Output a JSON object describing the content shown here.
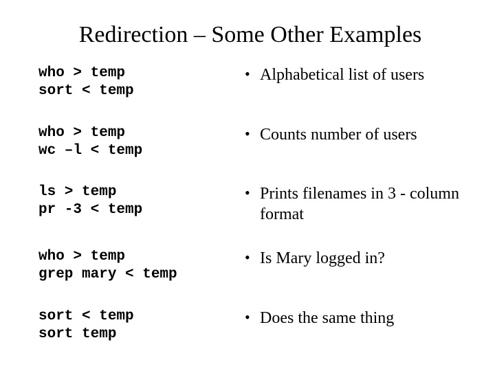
{
  "title": "Redirection – Some Other Examples",
  "rows": [
    {
      "cmd": "who > temp\nsort < temp",
      "desc": "Alphabetical list of users"
    },
    {
      "cmd": "who > temp\nwc –l < temp",
      "desc": "Counts number of users"
    },
    {
      "cmd": "ls > temp\npr -3 < temp",
      "desc": "Prints filenames in 3 - column format"
    },
    {
      "cmd": "who > temp\ngrep mary < temp",
      "desc": "Is Mary logged in?"
    },
    {
      "cmd": "sort < temp\nsort temp",
      "desc": "Does the same thing"
    }
  ],
  "bullet": "•"
}
